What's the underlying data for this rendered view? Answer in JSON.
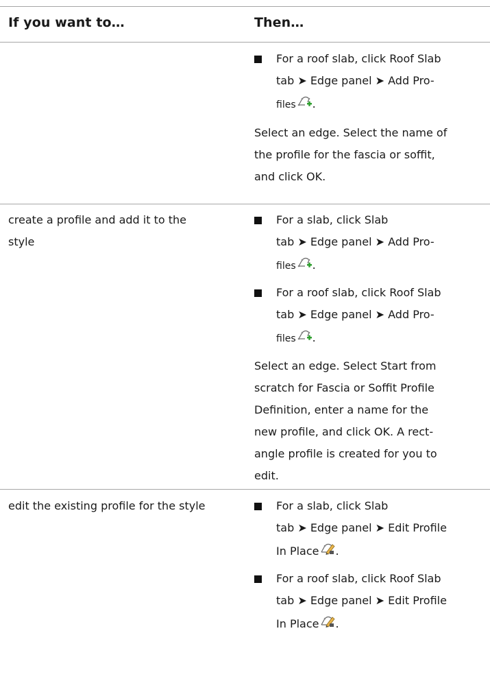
{
  "header": {
    "col1": "If you want to…",
    "col2": "Then…"
  },
  "row1": {
    "item1": {
      "l1": "For a roof slab, click Roof Slab",
      "l2": "tab ➤ Edge panel ➤ Add Pro-",
      "l3": "files"
    },
    "para": {
      "l1": "Select an edge. Select the name of",
      "l2": "the profile for the fascia or soffit,",
      "l3": "and click OK."
    }
  },
  "row2": {
    "left": {
      "l1": "create a profile and add it to the",
      "l2": "style"
    },
    "item1": {
      "l1": "For a slab, click Slab",
      "l2": "tab ➤ Edge panel ➤ Add Pro-",
      "l3": "files"
    },
    "item2": {
      "l1": "For a roof slab, click Roof Slab",
      "l2": "tab ➤ Edge panel ➤ Add Pro-",
      "l3": "files"
    },
    "para": {
      "l1": "Select an edge. Select Start from",
      "l2": "scratch for Fascia or Soffit Profile",
      "l3": "Definition, enter a name for the",
      "l4": "new profile, and click OK. A rect-",
      "l5": "angle profile is created for you to",
      "l6": "edit."
    }
  },
  "row3": {
    "left": {
      "l1": "edit the existing profile for the style"
    },
    "item1": {
      "l1": "For a slab, click Slab",
      "l2": "tab ➤ Edge panel ➤ Edit Profile",
      "l3": "In Place"
    },
    "item2": {
      "l1": "For a roof slab, click Roof Slab",
      "l2": "tab ➤ Edge panel ➤ Edit Profile",
      "l3": "In Place"
    }
  },
  "icons": {
    "add_profile": "add-profile-icon",
    "edit_profile_in_place": "edit-profile-in-place-icon"
  },
  "colors": {
    "rule": "#a6a6a6",
    "add_plus": "#2e9e2e"
  }
}
